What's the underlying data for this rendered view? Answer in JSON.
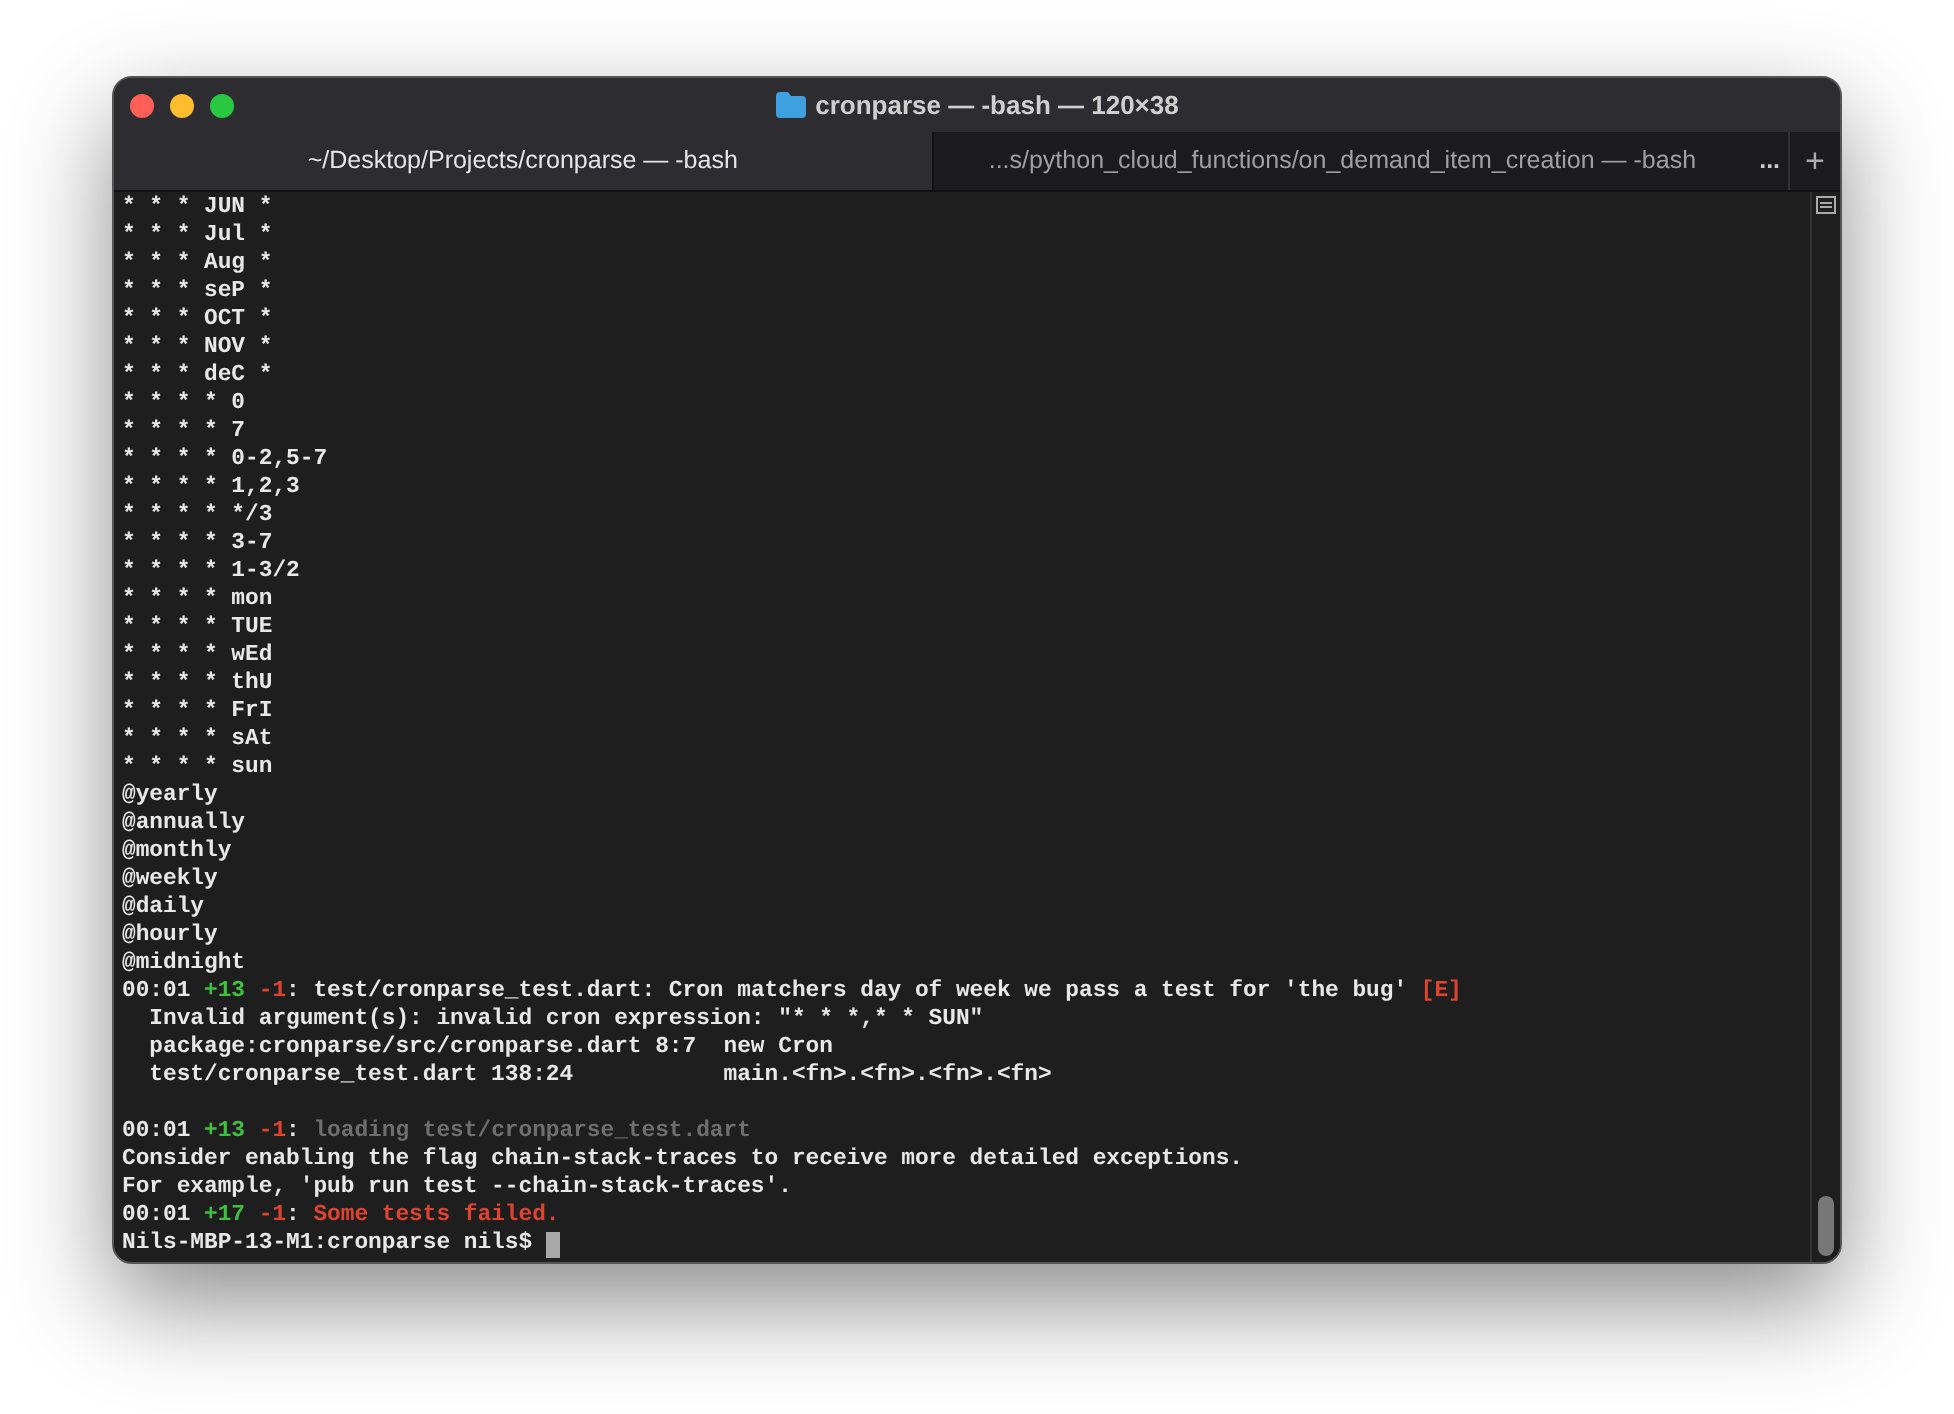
{
  "window": {
    "title": "cronparse — -bash — 120×38"
  },
  "tabs": [
    {
      "label": "~/Desktop/Projects/cronparse — -bash",
      "selected": true
    },
    {
      "label": "...s/python_cloud_functions/on_demand_item_creation — -bash",
      "selected": false
    }
  ],
  "tab_overflow": "...",
  "new_tab": "+",
  "lines": [
    {
      "kind": "output",
      "text": "* * * JUN *"
    },
    {
      "kind": "output",
      "text": "* * * Jul *"
    },
    {
      "kind": "output",
      "text": "* * * Aug *"
    },
    {
      "kind": "output",
      "text": "* * * seP *"
    },
    {
      "kind": "output",
      "text": "* * * OCT *"
    },
    {
      "kind": "output",
      "text": "* * * NOV *"
    },
    {
      "kind": "output",
      "text": "* * * deC *"
    },
    {
      "kind": "output",
      "text": "* * * * 0"
    },
    {
      "kind": "output",
      "text": "* * * * 7"
    },
    {
      "kind": "output",
      "text": "* * * * 0-2,5-7"
    },
    {
      "kind": "output",
      "text": "* * * * 1,2,3"
    },
    {
      "kind": "output",
      "text": "* * * * */3"
    },
    {
      "kind": "output",
      "text": "* * * * 3-7"
    },
    {
      "kind": "output",
      "text": "* * * * 1-3/2"
    },
    {
      "kind": "output",
      "text": "* * * * mon"
    },
    {
      "kind": "output",
      "text": "* * * * TUE"
    },
    {
      "kind": "output",
      "text": "* * * * wEd"
    },
    {
      "kind": "output",
      "text": "* * * * thU"
    },
    {
      "kind": "output",
      "text": "* * * * FrI"
    },
    {
      "kind": "output",
      "text": "* * * * sAt"
    },
    {
      "kind": "output",
      "text": "* * * * sun"
    },
    {
      "kind": "output",
      "text": "@yearly"
    },
    {
      "kind": "output",
      "text": "@annually"
    },
    {
      "kind": "output",
      "text": "@monthly"
    },
    {
      "kind": "output",
      "text": "@weekly"
    },
    {
      "kind": "output",
      "text": "@daily"
    },
    {
      "kind": "output",
      "text": "@hourly"
    },
    {
      "kind": "output",
      "text": "@midnight"
    },
    {
      "kind": "test_error",
      "time": "00:01",
      "passed": "+13",
      "failed": "-1",
      "separator": ":",
      "message": "test/cronparse_test.dart: Cron matchers day of week we pass a test for 'the bug'",
      "tag": "[E]"
    },
    {
      "kind": "output",
      "text": "  Invalid argument(s): invalid cron expression: \"* * *,* * SUN\""
    },
    {
      "kind": "output",
      "text": "  package:cronparse/src/cronparse.dart 8:7  new Cron"
    },
    {
      "kind": "output",
      "text": "  test/cronparse_test.dart 138:24           main.<fn>.<fn>.<fn>.<fn>"
    },
    {
      "kind": "blank"
    },
    {
      "kind": "loading",
      "time": "00:01",
      "passed": "+13",
      "failed": "-1",
      "separator": ":",
      "message": "loading test/cronparse_test.dart"
    },
    {
      "kind": "output",
      "text": "Consider enabling the flag chain-stack-traces to receive more detailed exceptions."
    },
    {
      "kind": "output",
      "text": "For example, 'pub run test --chain-stack-traces'."
    },
    {
      "kind": "summary_failed",
      "time": "00:01",
      "passed": "+17",
      "failed": "-1",
      "separator": ":",
      "message": "Some tests failed."
    },
    {
      "kind": "prompt",
      "text": "Nils-MBP-13-M1:cronparse nils$"
    }
  ]
}
